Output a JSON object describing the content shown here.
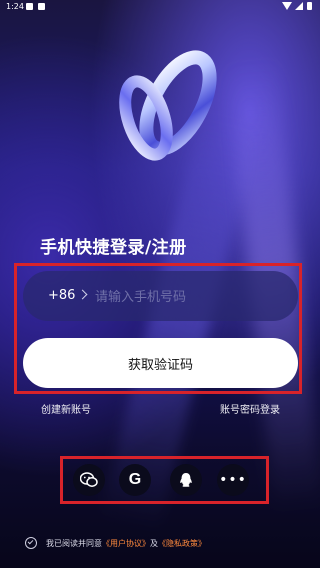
{
  "status_bar": {
    "time": "1:24"
  },
  "login": {
    "title": "手机快捷登录/注册",
    "country_code": "+86",
    "phone_placeholder": "请输入手机号码",
    "get_code_button": "获取验证码",
    "create_account": "创建新账号",
    "password_login": "账号密码登录"
  },
  "social_login": {
    "items": [
      {
        "name": "wechat",
        "icon": "wechat-icon"
      },
      {
        "name": "google",
        "icon": "google-icon",
        "glyph": "G"
      },
      {
        "name": "qq",
        "icon": "qq-icon"
      },
      {
        "name": "more",
        "icon": "more-icon",
        "glyph": "•••"
      }
    ]
  },
  "agreement": {
    "prefix": "我已阅读并同意",
    "user_agreement": "《用户协议》",
    "conjunction": "及",
    "privacy_policy": "《隐私政策》"
  },
  "colors": {
    "highlight_border": "#d8232a",
    "link_orange": "#ff8a3d",
    "button_bg": "#ffffff"
  }
}
